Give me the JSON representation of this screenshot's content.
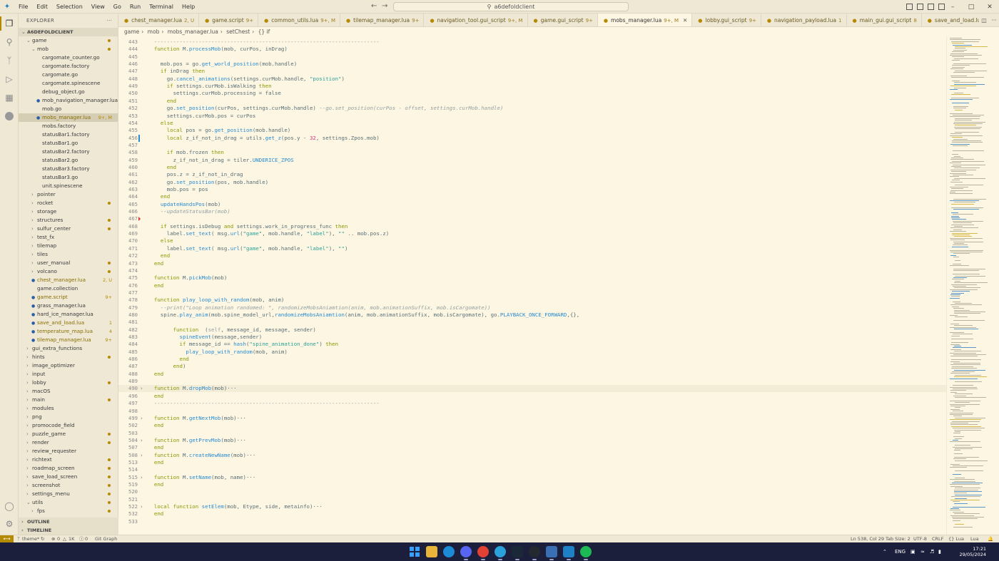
{
  "window": {
    "search": "a6defoldclient",
    "menu": [
      "File",
      "Edit",
      "Selection",
      "View",
      "Go",
      "Run",
      "Terminal",
      "Help"
    ]
  },
  "explorer": {
    "title": "EXPLORER",
    "root": "A6DEFOLDCLIENT",
    "outline": "OUTLINE",
    "timeline": "TIMELINE"
  },
  "tree": [
    {
      "label": "game",
      "indent": 1,
      "type": "open",
      "dot": true
    },
    {
      "label": "mob",
      "indent": 2,
      "type": "open",
      "dot": true
    },
    {
      "label": "cargomate_counter.go",
      "indent": 3
    },
    {
      "label": "cargomate.factory",
      "indent": 3
    },
    {
      "label": "cargomate.go",
      "indent": 3
    },
    {
      "label": "cargomate.spinescene",
      "indent": 3
    },
    {
      "label": "debug_object.go",
      "indent": 3
    },
    {
      "label": "mob_navigation_manager.lua",
      "indent": 3,
      "icon": "lua"
    },
    {
      "label": "mob.go",
      "indent": 3
    },
    {
      "label": "mobs_manager.lua",
      "indent": 3,
      "icon": "lua",
      "badge": "9+, M",
      "sel": true,
      "mod": true
    },
    {
      "label": "mobs.factory",
      "indent": 3
    },
    {
      "label": "statusBar1.factory",
      "indent": 3
    },
    {
      "label": "statusBar1.go",
      "indent": 3
    },
    {
      "label": "statusBar2.factory",
      "indent": 3
    },
    {
      "label": "statusBar2.go",
      "indent": 3
    },
    {
      "label": "statusBar3.factory",
      "indent": 3
    },
    {
      "label": "statusBar3.go",
      "indent": 3
    },
    {
      "label": "unit.spinescene",
      "indent": 3
    },
    {
      "label": "pointer",
      "indent": 2,
      "type": "closed"
    },
    {
      "label": "rocket",
      "indent": 2,
      "type": "closed",
      "dot": true
    },
    {
      "label": "storage",
      "indent": 2,
      "type": "closed"
    },
    {
      "label": "structures",
      "indent": 2,
      "type": "closed",
      "dot": true
    },
    {
      "label": "sulfur_center",
      "indent": 2,
      "type": "closed",
      "dot": true
    },
    {
      "label": "test_fx",
      "indent": 2,
      "type": "closed"
    },
    {
      "label": "tilemap",
      "indent": 2,
      "type": "closed"
    },
    {
      "label": "tiles",
      "indent": 2,
      "type": "closed"
    },
    {
      "label": "user_manual",
      "indent": 2,
      "type": "closed",
      "dot": true
    },
    {
      "label": "volcano",
      "indent": 2,
      "type": "closed",
      "dot": true
    },
    {
      "label": "chest_manager.lua",
      "indent": 2,
      "icon": "lua",
      "badge": "2, U",
      "mod": true
    },
    {
      "label": "game.collection",
      "indent": 2
    },
    {
      "label": "game.script",
      "indent": 2,
      "icon": "lua",
      "badge": "9+",
      "mod": true
    },
    {
      "label": "grass_manager.lua",
      "indent": 2,
      "icon": "lua"
    },
    {
      "label": "hard_ice_manager.lua",
      "indent": 2,
      "icon": "lua"
    },
    {
      "label": "save_and_load.lua",
      "indent": 2,
      "icon": "lua",
      "badge": "1",
      "mod": true
    },
    {
      "label": "temperature_map.lua",
      "indent": 2,
      "icon": "lua",
      "badge": "4",
      "mod": true
    },
    {
      "label": "tilemap_manager.lua",
      "indent": 2,
      "icon": "lua",
      "badge": "9+",
      "mod": true
    },
    {
      "label": "gui_extra_functions",
      "indent": 1,
      "type": "closed"
    },
    {
      "label": "hints",
      "indent": 1,
      "type": "closed",
      "dot": true
    },
    {
      "label": "image_optimizer",
      "indent": 1,
      "type": "closed"
    },
    {
      "label": "input",
      "indent": 1,
      "type": "closed"
    },
    {
      "label": "lobby",
      "indent": 1,
      "type": "closed",
      "dot": true
    },
    {
      "label": "macOS",
      "indent": 1,
      "type": "closed"
    },
    {
      "label": "main",
      "indent": 1,
      "type": "closed",
      "dot": true
    },
    {
      "label": "modules",
      "indent": 1,
      "type": "closed"
    },
    {
      "label": "png",
      "indent": 1,
      "type": "closed"
    },
    {
      "label": "promocode_field",
      "indent": 1,
      "type": "closed"
    },
    {
      "label": "puzzle_game",
      "indent": 1,
      "type": "closed",
      "dot": true
    },
    {
      "label": "render",
      "indent": 1,
      "type": "closed",
      "dot": true
    },
    {
      "label": "review_requester",
      "indent": 1,
      "type": "closed"
    },
    {
      "label": "richtext",
      "indent": 1,
      "type": "closed",
      "dot": true
    },
    {
      "label": "roadmap_screen",
      "indent": 1,
      "type": "closed",
      "dot": true
    },
    {
      "label": "save_load_screen",
      "indent": 1,
      "type": "closed",
      "dot": true
    },
    {
      "label": "screenshot",
      "indent": 1,
      "type": "closed",
      "dot": true
    },
    {
      "label": "settings_menu",
      "indent": 1,
      "type": "closed",
      "dot": true
    },
    {
      "label": "utils",
      "indent": 1,
      "type": "open",
      "dot": true
    },
    {
      "label": "fps",
      "indent": 2,
      "type": "closed",
      "dot": true
    }
  ],
  "tabs": [
    {
      "label": "chest_manager.lua",
      "status": "2, U"
    },
    {
      "label": "game.script",
      "status": "9+"
    },
    {
      "label": "common_utils.lua",
      "status": "9+, M"
    },
    {
      "label": "tilemap_manager.lua",
      "status": "9+"
    },
    {
      "label": "navigation_tool.gui_script",
      "status": "9+, M"
    },
    {
      "label": "game.gui_script",
      "status": "9+"
    },
    {
      "label": "mobs_manager.lua",
      "status": "9+, M",
      "active": true
    },
    {
      "label": "lobby.gui_script",
      "status": "9+"
    },
    {
      "label": "navigation_payload.lua",
      "status": "1"
    },
    {
      "label": "main_gui.gui_script",
      "status": "8"
    },
    {
      "label": "save_and_load.lua",
      "status": "9+"
    }
  ],
  "breadcrumb": [
    "game",
    "mob",
    "mobs_manager.lua",
    "setChest",
    "{} if"
  ],
  "code": [
    {
      "n": "443",
      "t": "  -----------------------------------------------------------------------"
    },
    {
      "n": "444",
      "t": "  function M.processMob(mob, curPos, inDrag)"
    },
    {
      "n": "445",
      "t": ""
    },
    {
      "n": "446",
      "t": "    mob.pos = go.get_world_position(mob.handle)"
    },
    {
      "n": "447",
      "t": "    if inDrag then"
    },
    {
      "n": "448",
      "t": "      go.cancel_animations(settings.curMob.handle, \"position\")"
    },
    {
      "n": "449",
      "t": "      if settings.curMob.isWalking then"
    },
    {
      "n": "450",
      "t": "        settings.curMob.processing = false"
    },
    {
      "n": "451",
      "t": "      end"
    },
    {
      "n": "452",
      "t": "      go.set_position(curPos, settings.curMob.handle) --go.set_position(curPos - offset, settings.curMob.handle)"
    },
    {
      "n": "453",
      "t": "      settings.curMob.pos = curPos"
    },
    {
      "n": "454",
      "t": "    else"
    },
    {
      "n": "455",
      "t": "      local pos = go.get_position(mob.handle)"
    },
    {
      "n": "456",
      "t": "      local z_if_not_in_drag = utils.get_z(pos.y - 32, settings.Zpos.mob)",
      "mod": true
    },
    {
      "n": "457",
      "t": ""
    },
    {
      "n": "458",
      "t": "      if mob.frozen then"
    },
    {
      "n": "459",
      "t": "        z_if_not_in_drag = tiler.UNDERICE_ZPOS"
    },
    {
      "n": "460",
      "t": "      end"
    },
    {
      "n": "461",
      "t": "      pos.z = z_if_not_in_drag"
    },
    {
      "n": "462",
      "t": "      go.set_position(pos, mob.handle)"
    },
    {
      "n": "463",
      "t": "      mob.pos = pos"
    },
    {
      "n": "464",
      "t": "    end"
    },
    {
      "n": "465",
      "t": "    updateHandsPos(mob)"
    },
    {
      "n": "466",
      "t": "    --updateStatusBar(mob)"
    },
    {
      "n": "467",
      "t": "",
      "err": true
    },
    {
      "n": "468",
      "t": "    if settings.isDebug and settings.work_in_progress_func then"
    },
    {
      "n": "469",
      "t": "      label.set_text( msg.url(\"game\", mob.handle, \"label\"), \"\" .. mob.pos.z)"
    },
    {
      "n": "470",
      "t": "    else"
    },
    {
      "n": "471",
      "t": "      label.set_text( msg.url(\"game\", mob.handle, \"label\"), \"\")"
    },
    {
      "n": "472",
      "t": "    end"
    },
    {
      "n": "473",
      "t": "  end"
    },
    {
      "n": "474",
      "t": ""
    },
    {
      "n": "475",
      "t": "  function M.pickMob(mob)"
    },
    {
      "n": "476",
      "t": "  end"
    },
    {
      "n": "477",
      "t": ""
    },
    {
      "n": "478",
      "t": "  function play_loop_with_random(mob, anim)"
    },
    {
      "n": "479",
      "t": "    --print(\"Loop animation randomed: \", randomizeMobsAniamtion(anim, mob.animationSuffix, mob.isCargomate))"
    },
    {
      "n": "480",
      "t": "    spine.play_anim(mob.spine_model_url,randomizeMobsAniamtion(anim, mob.animationSuffix, mob.isCargomate), go.PLAYBACK_ONCE_FORWARD,{},"
    },
    {
      "n": "481",
      "t": ""
    },
    {
      "n": "482",
      "t": "        function  (self, message_id, message, sender)"
    },
    {
      "n": "483",
      "t": "          spineEvent(message,sender)"
    },
    {
      "n": "484",
      "t": "          if message_id == hash(\"spine_animation_done\") then"
    },
    {
      "n": "485",
      "t": "            play_loop_with_random(mob, anim)"
    },
    {
      "n": "486",
      "t": "          end"
    },
    {
      "n": "487",
      "t": "        end)"
    },
    {
      "n": "488",
      "t": "  end"
    },
    {
      "n": "489",
      "t": ""
    },
    {
      "n": "490",
      "t": "  function M.dropMob(mob)···",
      "fold": true,
      "hl": true
    },
    {
      "n": "496",
      "t": "  end"
    },
    {
      "n": "497",
      "t": "  -----------------------------------------------------------------------"
    },
    {
      "n": "498",
      "t": ""
    },
    {
      "n": "499",
      "t": "  function M.getNextMob(mob)···",
      "fold": true
    },
    {
      "n": "502",
      "t": "  end"
    },
    {
      "n": "503",
      "t": ""
    },
    {
      "n": "504",
      "t": "  function M.getPrevMob(mob)···",
      "fold": true
    },
    {
      "n": "507",
      "t": "  end"
    },
    {
      "n": "508",
      "t": "  function M.createNewName(mob)···",
      "fold": true
    },
    {
      "n": "513",
      "t": "  end"
    },
    {
      "n": "514",
      "t": ""
    },
    {
      "n": "515",
      "t": "  function M.setName(mob, name)···",
      "fold": true
    },
    {
      "n": "519",
      "t": "  end"
    },
    {
      "n": "520",
      "t": ""
    },
    {
      "n": "521",
      "t": ""
    },
    {
      "n": "522",
      "t": "  local function setElem(mob, Etype, side, metainfo)···",
      "fold": true
    },
    {
      "n": "532",
      "t": "  end"
    },
    {
      "n": "533",
      "t": ""
    }
  ],
  "status": {
    "branch": "theme*",
    "errors": "0",
    "warnings": "1K",
    "info": "0",
    "git_graph": "Git Graph",
    "position": "Ln 538, Col 29",
    "tab_size": "Tab Size: 2",
    "encoding": "UTF-8",
    "eol": "CRLF",
    "language_mode": "{} Lua",
    "lua": "Lua"
  },
  "taskbar": {
    "lang": "ENG",
    "time": "17:21",
    "date": "29/05/2024"
  },
  "colors": {
    "accent": "#b58900",
    "keyword": "#859900",
    "string": "#2aa198",
    "comment": "#93a1a1",
    "taskbar": "#1c1f3c"
  }
}
